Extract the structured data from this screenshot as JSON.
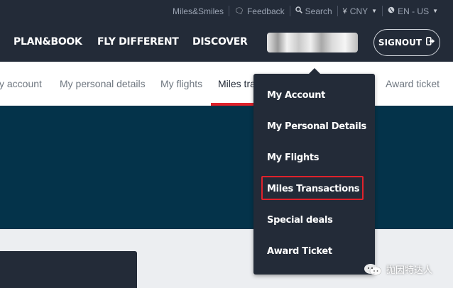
{
  "topbar": {
    "items": [
      {
        "label": "Miles&Smiles",
        "icon": "",
        "caret": false
      },
      {
        "label": "Feedback",
        "icon": "chat-bubble-icon",
        "caret": false
      },
      {
        "label": "Search",
        "icon": "search-icon",
        "caret": false
      },
      {
        "label": "CNY",
        "icon": "yen-icon",
        "caret": true
      },
      {
        "label": "EN - US",
        "icon": "globe-icon",
        "caret": true
      }
    ]
  },
  "nav": {
    "links": [
      "PLAN&BOOK",
      "FLY DIFFERENT",
      "DISCOVER"
    ],
    "signout_label": "SIGNOUT"
  },
  "subtabs": {
    "items": [
      "y account",
      "My personal details",
      "My flights",
      "Miles tra",
      "Award ticket"
    ],
    "active_index": 3
  },
  "dropdown": {
    "items": [
      "My Account",
      "My Personal Details",
      "My Flights",
      "Miles Transactions",
      "Special deals",
      "Award Ticket"
    ],
    "highlighted_index": 3
  },
  "watermark": {
    "text": "抛因特达人"
  },
  "colors": {
    "nav_bg": "#232b38",
    "hero_bg": "#04334a",
    "accent_red": "#e0222b",
    "content_bg": "#eceef1"
  }
}
